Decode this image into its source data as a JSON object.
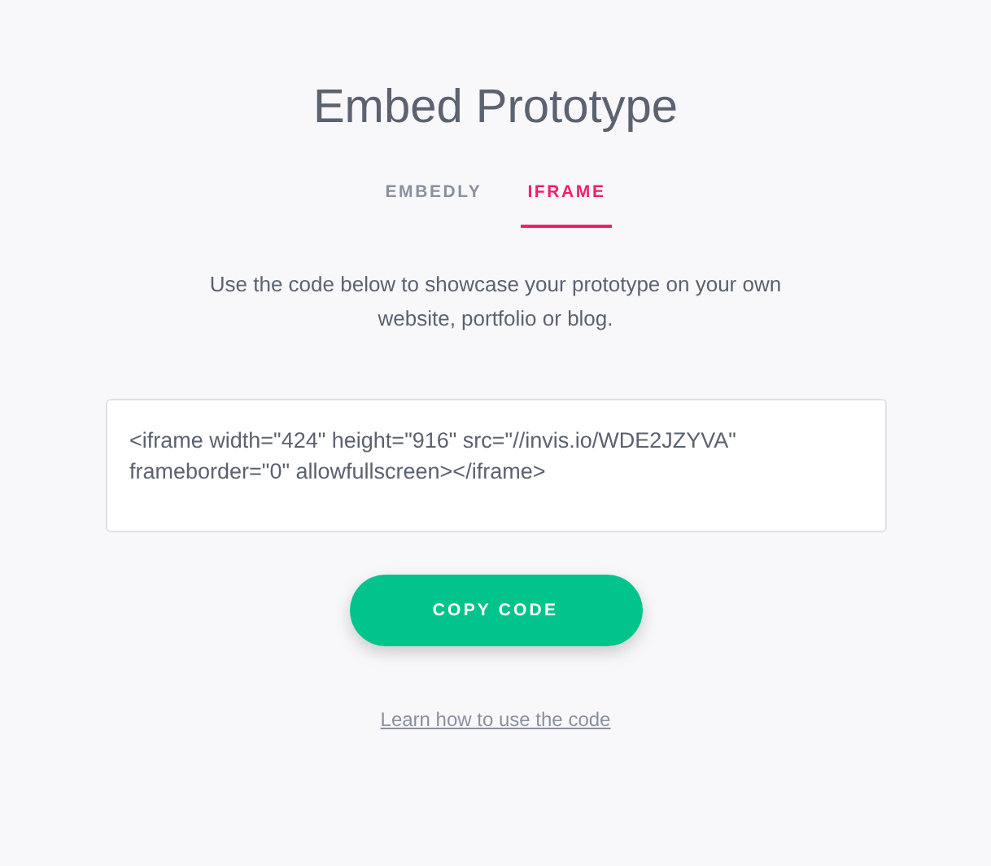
{
  "title": "Embed Prototype",
  "tabs": [
    {
      "label": "EMBEDLY",
      "selected": false
    },
    {
      "label": "IFRAME",
      "selected": true
    }
  ],
  "description": "Use the code below to showcase your prototype on your own website, portfolio or blog.",
  "code_field": {
    "value": "<iframe width=\"424\" height=\"916\" src=\"//invis.io/WDE2JZYVA\" frameborder=\"0\" allowfullscreen></iframe>"
  },
  "copy_button": "COPY CODE",
  "help_link": "Learn how to use the code"
}
